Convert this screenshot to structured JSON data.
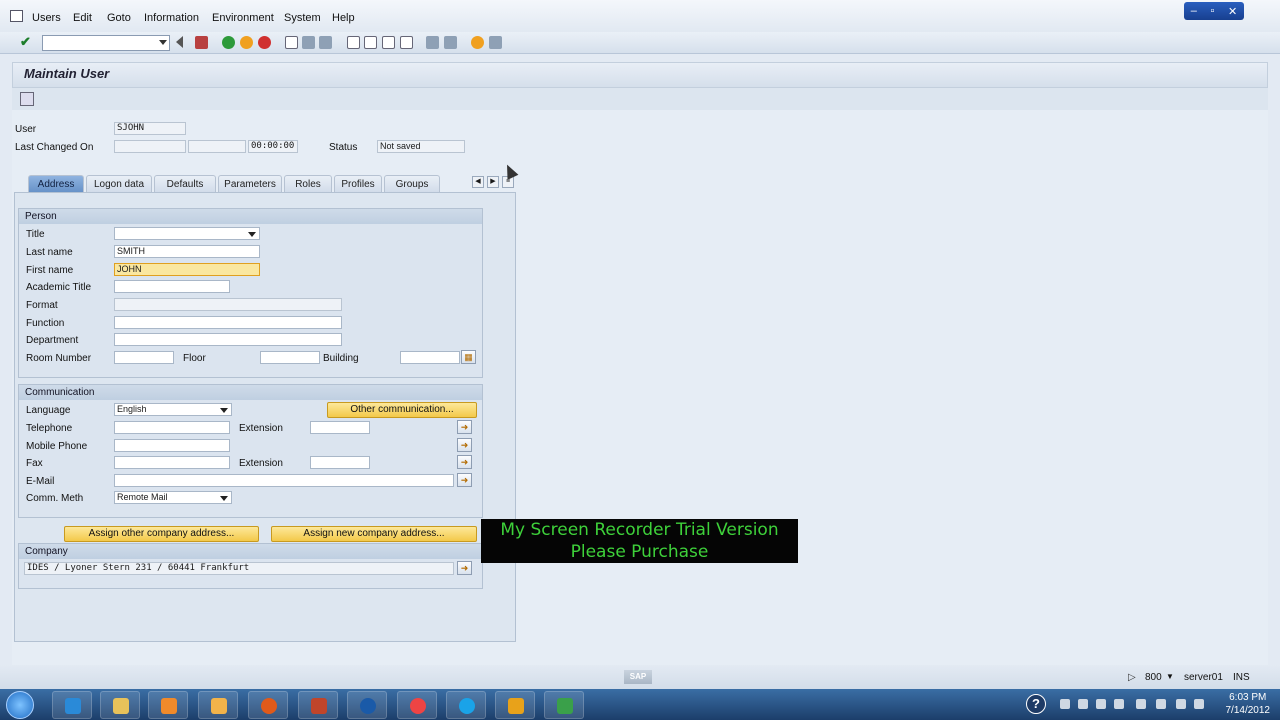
{
  "menu": [
    "Users",
    "Edit",
    "Goto",
    "Information",
    "Environment",
    "System",
    "Help"
  ],
  "window_controls": [
    "–",
    "▫",
    "✕"
  ],
  "page_title": "Maintain User",
  "header": {
    "user_label": "User",
    "user_value": "SJOHN",
    "last_changed_label": "Last Changed On",
    "last_changed_time": "00:00:00",
    "status_label": "Status",
    "status_value": "Not saved"
  },
  "tabs": [
    "Address",
    "Logon data",
    "Defaults",
    "Parameters",
    "Roles",
    "Profiles",
    "Groups"
  ],
  "active_tab": "Address",
  "person": {
    "title": "Person",
    "title_label": "Title",
    "title_value": "",
    "last_name_label": "Last name",
    "last_name_value": "SMITH",
    "first_name_label": "First name",
    "first_name_value": "JOHN",
    "academic_title_label": "Academic Title",
    "format_label": "Format",
    "function_label": "Function",
    "department_label": "Department",
    "room_label": "Room Number",
    "floor_label": "Floor",
    "building_label": "Building"
  },
  "communication": {
    "title": "Communication",
    "language_label": "Language",
    "language_value": "English",
    "other_button": "Other communication...",
    "telephone_label": "Telephone",
    "extension_label": "Extension",
    "mobile_label": "Mobile Phone",
    "fax_label": "Fax",
    "fax_extension_label": "Extension",
    "email_label": "E-Mail",
    "comm_method_label": "Comm. Meth",
    "comm_method_value": "Remote Mail"
  },
  "buttons": {
    "assign_other": "Assign other company address...",
    "assign_new": "Assign new company address..."
  },
  "company": {
    "title": "Company",
    "address": "IDES / Lyoner Stern 231 / 60441 Frankfurt"
  },
  "watermark": {
    "line1": "My Screen Recorder Trial Version",
    "line2": "Please Purchase"
  },
  "statusbar": {
    "sap_logo": "SAP",
    "client": "800",
    "server": "server01",
    "mode": "INS"
  },
  "taskbar": {
    "time": "6:03 PM",
    "date": "7/14/2012"
  },
  "colors": {
    "active_tab": "#6792c8",
    "active_field": "#fae7a0",
    "watermark_text": "#3ed13a"
  }
}
